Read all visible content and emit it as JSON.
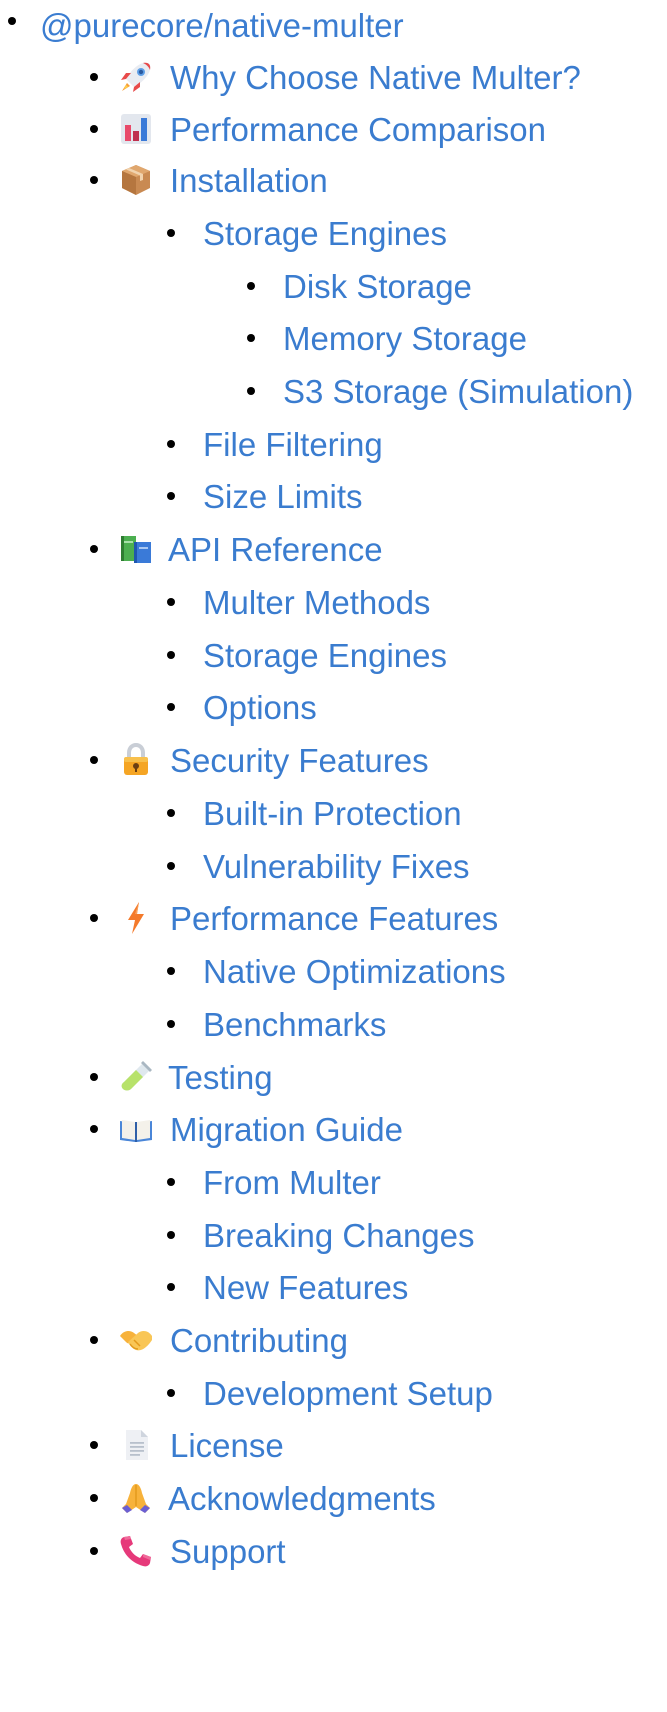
{
  "toc": {
    "root": {
      "label": "@purecore/native-multer"
    },
    "items": [
      {
        "label": "Why Choose Native Multer?",
        "icon": "rocket-icon"
      },
      {
        "label": "Performance Comparison",
        "icon": "bar-chart-icon"
      },
      {
        "label": "Installation",
        "icon": "package-icon"
      },
      {
        "label": "Storage Engines"
      },
      {
        "label": "Disk Storage"
      },
      {
        "label": "Memory Storage"
      },
      {
        "label": "S3 Storage (Simulation)"
      },
      {
        "label": "File Filtering"
      },
      {
        "label": "Size Limits"
      },
      {
        "label": "API Reference",
        "icon": "books-icon"
      },
      {
        "label": "Multer Methods"
      },
      {
        "label": "Storage Engines"
      },
      {
        "label": "Options"
      },
      {
        "label": "Security Features",
        "icon": "lock-icon"
      },
      {
        "label": "Built-in Protection"
      },
      {
        "label": "Vulnerability Fixes"
      },
      {
        "label": "Performance Features",
        "icon": "lightning-icon"
      },
      {
        "label": "Native Optimizations"
      },
      {
        "label": "Benchmarks"
      },
      {
        "label": "Testing",
        "icon": "test-tube-icon"
      },
      {
        "label": "Migration Guide",
        "icon": "open-book-icon"
      },
      {
        "label": "From Multer"
      },
      {
        "label": "Breaking Changes"
      },
      {
        "label": "New Features"
      },
      {
        "label": "Contributing",
        "icon": "handshake-icon"
      },
      {
        "label": "Development Setup"
      },
      {
        "label": "License",
        "icon": "document-icon"
      },
      {
        "label": "Acknowledgments",
        "icon": "praying-hands-icon"
      },
      {
        "label": "Support",
        "icon": "telephone-icon"
      }
    ]
  },
  "colors": {
    "link": "#3a7ccf",
    "bullet": "#000000",
    "background": "#ffffff"
  }
}
